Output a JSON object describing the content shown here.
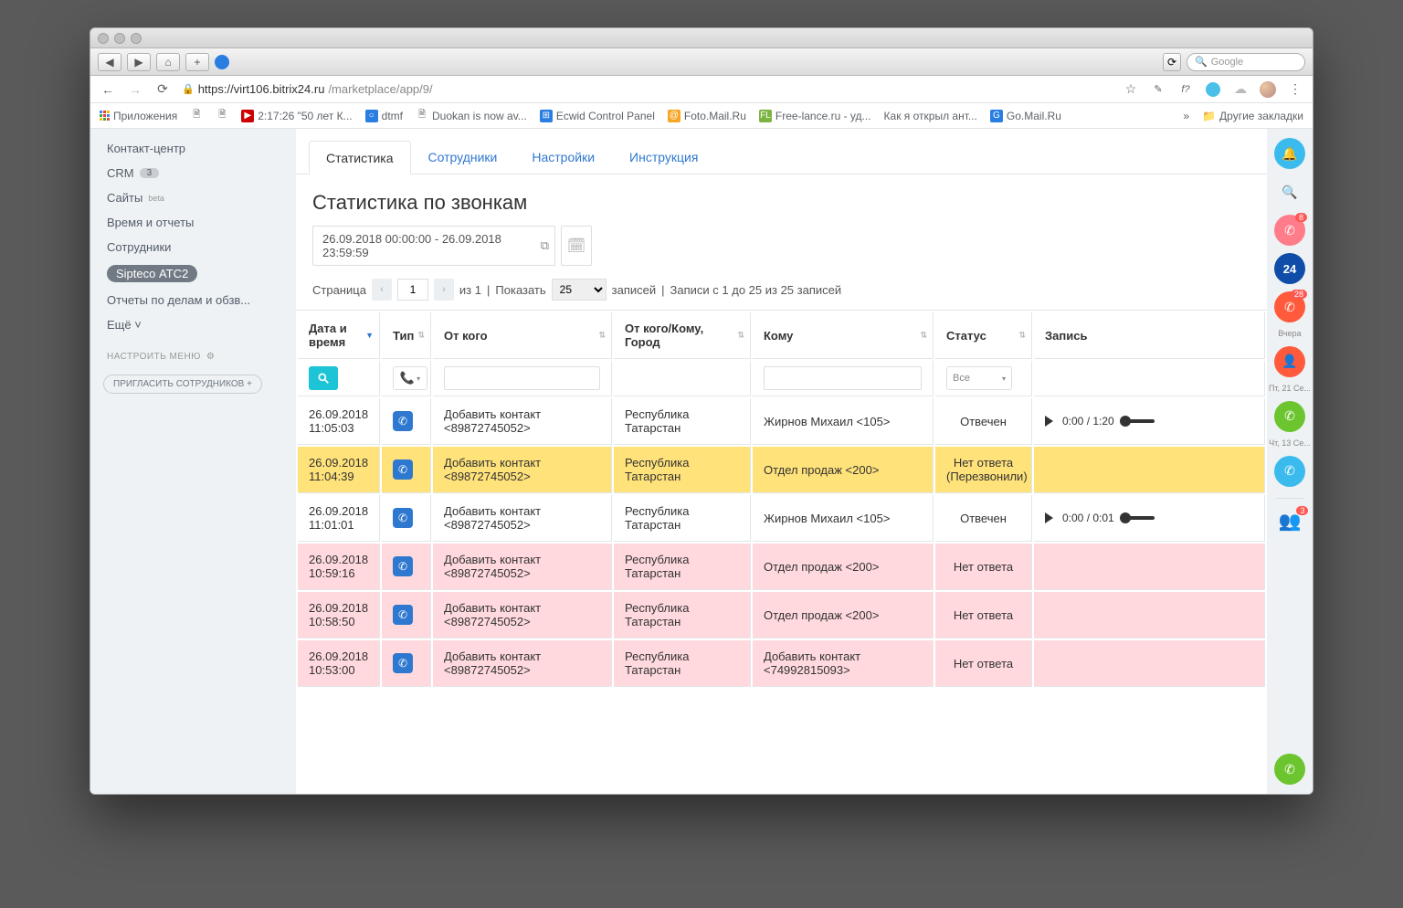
{
  "safari": {
    "search_placeholder": "Google"
  },
  "url": {
    "host": "https://virt106.bitrix24.ru",
    "path": "/marketplace/app/9/"
  },
  "bookmarks": {
    "apps": "Приложения",
    "items": [
      "2:17:26 \"50 лет К...",
      "dtmf",
      "Duokan is now av...",
      "Ecwid Control Panel",
      "Foto.Mail.Ru",
      "Free-lance.ru - уд...",
      "Как я открыл ант...",
      "Go.Mail.Ru"
    ],
    "more": "»",
    "other": "Другие закладки"
  },
  "sidebar": {
    "items": [
      {
        "label": "Контакт-центр"
      },
      {
        "label": "CRM",
        "pill": "3"
      },
      {
        "label": "Сайты",
        "beta": "beta"
      },
      {
        "label": "Время и отчеты"
      },
      {
        "label": "Сотрудники"
      },
      {
        "label": "Sipteco АТС2",
        "active": true
      },
      {
        "label": "Отчеты по делам и обзв..."
      },
      {
        "label": "Ещё ˅"
      }
    ],
    "configure": "НАСТРОИТЬ МЕНЮ",
    "invite": "ПРИГЛАСИТЬ СОТРУДНИКОВ  +"
  },
  "tabs": [
    "Статистика",
    "Сотрудники",
    "Настройки",
    "Инструкция"
  ],
  "page_title": "Статистика по звонкам",
  "date_range": "26.09.2018 00:00:00 - 26.09.2018 23:59:59",
  "pager": {
    "page_label": "Страница",
    "page": "1",
    "of": "из 1",
    "show_label": "Показать",
    "page_size": "25",
    "records": "записей",
    "summary": "Записи с 1 до 25 из 25 записей"
  },
  "columns": [
    "Дата и время",
    "Тип",
    "От кого",
    "От кого/Кому, Город",
    "Кому",
    "Статус",
    "Запись"
  ],
  "filter_status": "Все",
  "rows": [
    {
      "dt": "26.09.2018 11:05:03",
      "from": "Добавить контакт <89872745052>",
      "city": "Республика Татарстан",
      "to": "Жирнов Михаил <105>",
      "status": "Отвечен",
      "rec": "0:00 / 1:20",
      "cls": ""
    },
    {
      "dt": "26.09.2018 11:04:39",
      "from": "Добавить контакт <89872745052>",
      "city": "Республика Татарстан",
      "to": "Отдел продаж <200>",
      "status": "Нет ответа (Перезвонили)",
      "rec": "",
      "cls": "row-yellow"
    },
    {
      "dt": "26.09.2018 11:01:01",
      "from": "Добавить контакт <89872745052>",
      "city": "Республика Татарстан",
      "to": "Жирнов Михаил <105>",
      "status": "Отвечен",
      "rec": "0:00 / 0:01",
      "cls": ""
    },
    {
      "dt": "26.09.2018 10:59:16",
      "from": "Добавить контакт <89872745052>",
      "city": "Республика Татарстан",
      "to": "Отдел продаж <200>",
      "status": "Нет ответа",
      "rec": "",
      "cls": "row-pink"
    },
    {
      "dt": "26.09.2018 10:58:50",
      "from": "Добавить контакт <89872745052>",
      "city": "Республика Татарстан",
      "to": "Отдел продаж <200>",
      "status": "Нет ответа",
      "rec": "",
      "cls": "row-pink"
    },
    {
      "dt": "26.09.2018 10:53:00",
      "from": "Добавить контакт <89872745052>",
      "city": "Республика Татарстан",
      "to": "Добавить контакт <74992815093>",
      "status": "Нет ответа",
      "rec": "",
      "cls": "row-pink"
    }
  ],
  "rail": {
    "items": [
      {
        "color": "#3bbbed",
        "icon": "bell",
        "badge": ""
      },
      {
        "color": "",
        "icon": "search",
        "badge": ""
      },
      {
        "color": "#ff7d8a",
        "icon": "phone",
        "badge": "8"
      },
      {
        "color": "#0f4da8",
        "icon": "24",
        "badge": ""
      },
      {
        "color": "#ff5a3c",
        "icon": "phone",
        "badge": "28"
      }
    ],
    "labels": [
      "Вчера",
      "Пт, 21 Се...",
      "Чт, 13 Се..."
    ],
    "below": [
      {
        "color": "#ff5a3c",
        "icon": "user",
        "badge": ""
      },
      {
        "color": "#6cc52e",
        "icon": "phone",
        "badge": ""
      },
      {
        "color": "#3bbbed",
        "icon": "phone",
        "badge": ""
      }
    ],
    "avatar_badge": "3"
  }
}
